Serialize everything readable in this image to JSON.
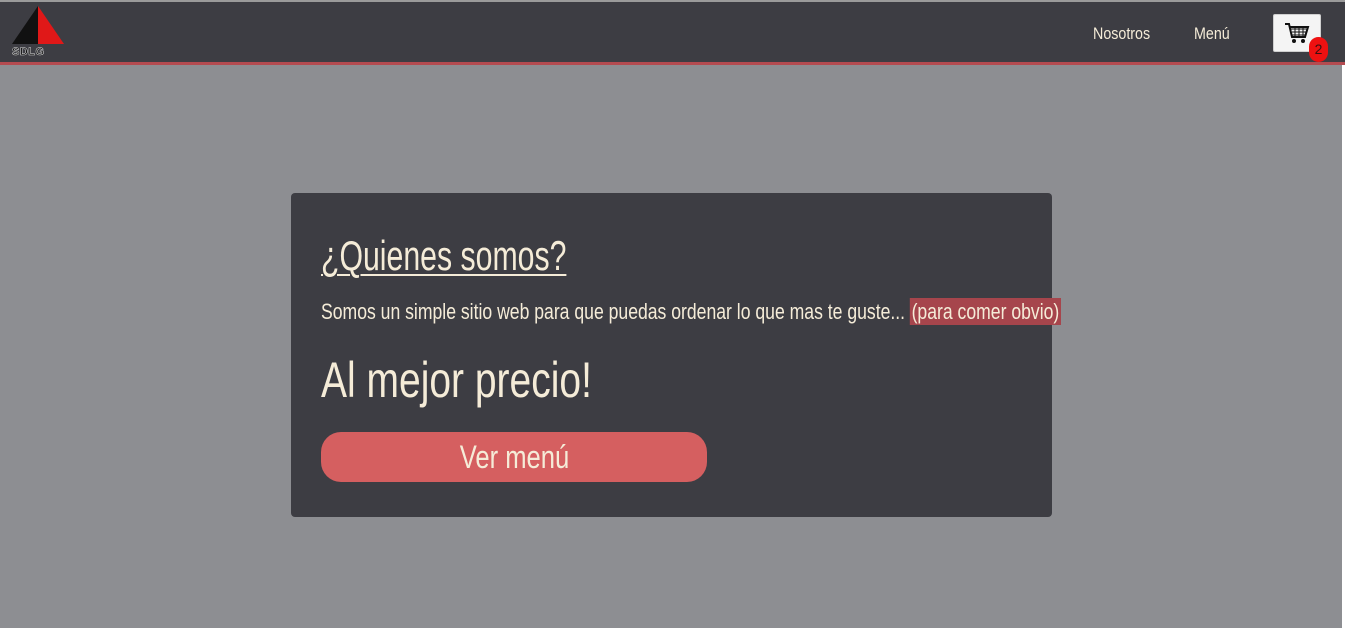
{
  "header": {
    "logo_text": "SDLG",
    "nav": {
      "nosotros": "Nosotros",
      "menu": "Menú"
    },
    "cart": {
      "icon": "shopping-cart-icon",
      "count": "2"
    }
  },
  "main": {
    "title": "¿Quienes somos?",
    "description": "Somos un simple sitio web para que puedas ordenar lo que mas te guste...",
    "highlight": "(para comer obvio)",
    "tagline": "Al mejor precio!",
    "button_label": "Ver menú"
  },
  "colors": {
    "background": "#8d8e92",
    "navbar": "#3d3d43",
    "card": "#3d3d43",
    "accent": "#d55f60",
    "highlight": "#a6454c",
    "text": "#f5ecd8",
    "badge": "#ee1111"
  }
}
